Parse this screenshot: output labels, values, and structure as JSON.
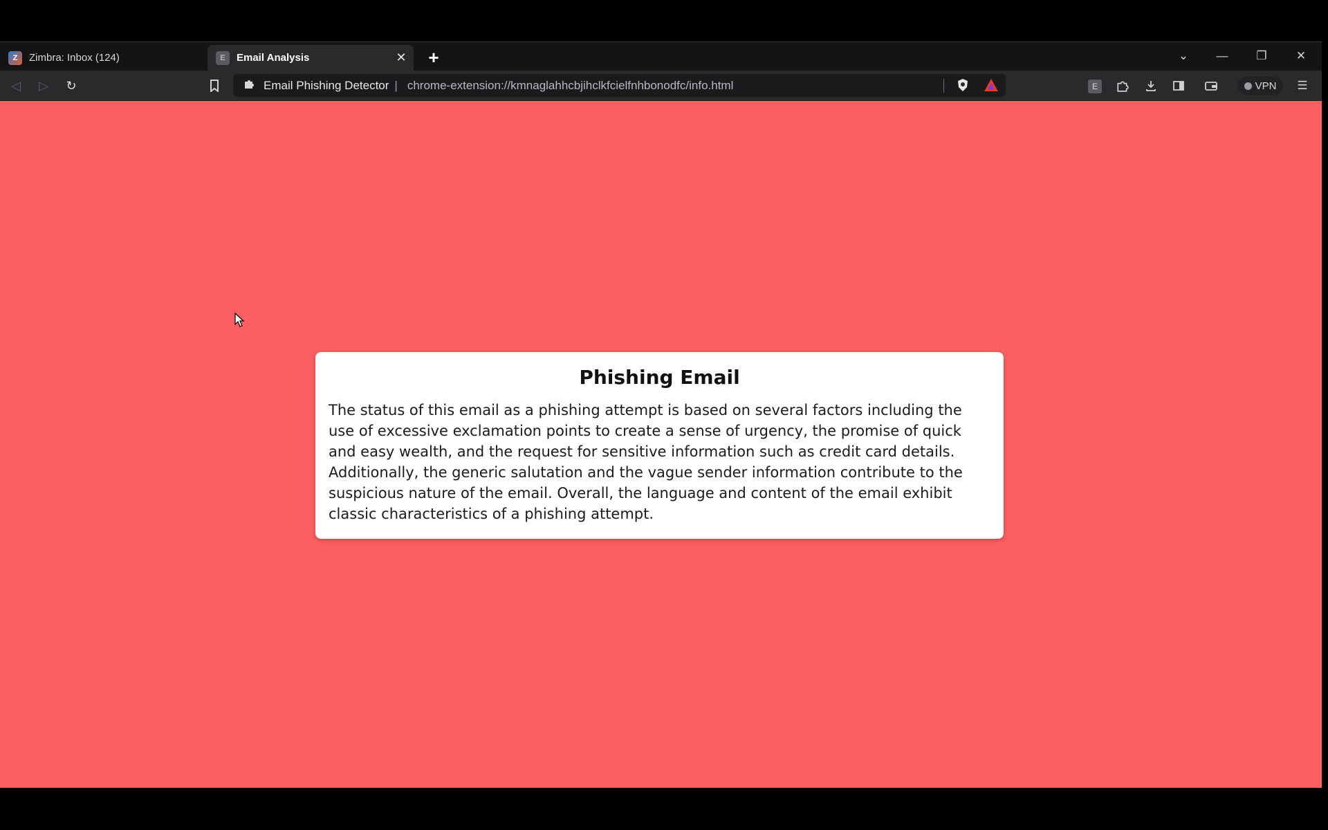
{
  "tabs": [
    {
      "title": "Zimbra: Inbox (124)",
      "favicon": "Z",
      "active": false
    },
    {
      "title": "Email Analysis",
      "favicon": "E",
      "active": true
    }
  ],
  "toolbar": {
    "site_name": "Email Phishing Detector",
    "separator": "|",
    "url": "chrome-extension://kmnaglahhcbjihclkfcielfnhbonodfc/info.html",
    "vpn_label": "VPN",
    "extension_badge": "E"
  },
  "icons": {
    "back": "back-arrow-icon",
    "forward": "forward-arrow-icon",
    "reload": "reload-icon",
    "bookmark": "bookmark-icon",
    "extension": "puzzle-icon",
    "brave_shield": "brave-shield-icon",
    "brave_rewards": "bat-triangle-icon",
    "downloads": "download-icon",
    "sidebar": "sidebar-icon",
    "wallet": "wallet-icon",
    "menu": "hamburger-menu-icon"
  },
  "result": {
    "heading": "Phishing Email",
    "body": "The status of this email as a phishing attempt is based on several factors including the use of excessive exclamation points to create a sense of urgency, the promise of quick and easy wealth, and the request for sensitive information such as credit card details. Additionally, the generic salutation and the vague sender information contribute to the suspicious nature of the email. Overall, the language and content of the email exhibit classic characteristics of a phishing attempt."
  },
  "colors": {
    "page_background": "#fc5f5f",
    "card_background": "#ffffff"
  }
}
